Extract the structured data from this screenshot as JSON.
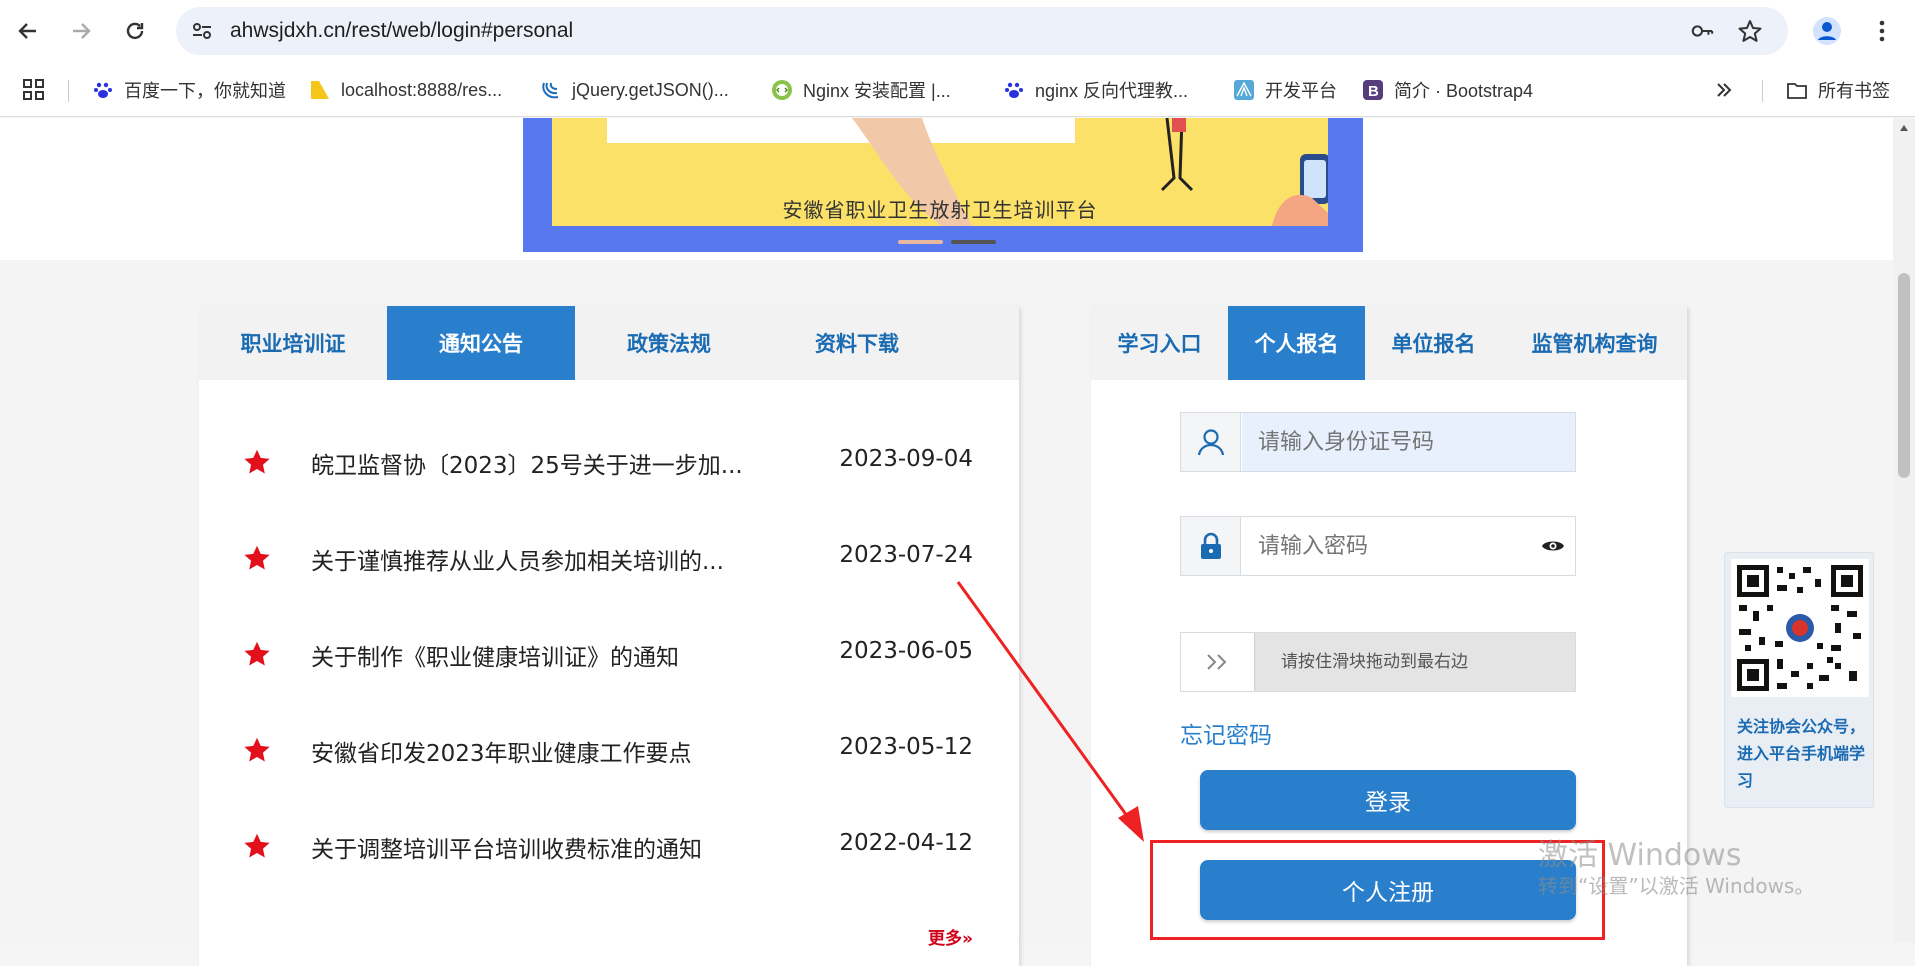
{
  "browser": {
    "url": "ahwsjdxh.cn/rest/web/login#personal",
    "bookmarks": [
      {
        "label": "百度一下，你就知道",
        "icon": "baidu-icon"
      },
      {
        "label": "localhost:8888/res...",
        "icon": "folder-yellow-icon"
      },
      {
        "label": "jQuery.getJSON()...",
        "icon": "jquery-icon"
      },
      {
        "label": "Nginx 安装配置 |...",
        "icon": "code-icon"
      },
      {
        "label": "nginx 反向代理教...",
        "icon": "baidu-icon"
      },
      {
        "label": "开发平台",
        "icon": "shell-icon"
      },
      {
        "label": "简介 · Bootstrap4",
        "icon": "bootstrap-icon"
      }
    ],
    "all_bookmarks": "所有书签"
  },
  "banner": {
    "title": "安徽省职业卫生放射卫生培训平台"
  },
  "notice_panel": {
    "tabs": [
      "职业培训证",
      "通知公告",
      "政策法规",
      "资料下载"
    ],
    "active_tab": 1,
    "items": [
      {
        "title": "皖卫监督协〔2023〕25号关于进一步加...",
        "date": "2023-09-04"
      },
      {
        "title": "关于谨慎推荐从业人员参加相关培训的...",
        "date": "2023-07-24"
      },
      {
        "title": "关于制作《职业健康培训证》的通知",
        "date": "2023-06-05"
      },
      {
        "title": "安徽省印发2023年职业健康工作要点",
        "date": "2023-05-12"
      },
      {
        "title": "关于调整培训平台培训收费标准的通知",
        "date": "2022-04-12"
      }
    ],
    "more": "更多»"
  },
  "login_panel": {
    "tabs": [
      "学习入口",
      "个人报名",
      "单位报名",
      "监管机构查询"
    ],
    "active_tab": 1,
    "id_placeholder": "请输入身份证号码",
    "password_placeholder": "请输入密码",
    "slider_text": "请按住滑块拖动到最右边",
    "forgot": "忘记密码",
    "login_button": "登录",
    "register_button": "个人注册"
  },
  "qr_widget": {
    "text": "关注协会公众号，进入平台手机端学习"
  },
  "watermark": {
    "line1": "激活 Windows",
    "line2": "转到“设置”以激活 Windows。"
  },
  "colors": {
    "primary": "#2a7fcc",
    "tab_text": "#1b6bb3",
    "star": "#e3101b",
    "annotation": "#ee2222",
    "banner_blue": "#5878ef",
    "banner_yellow": "#fce169"
  }
}
